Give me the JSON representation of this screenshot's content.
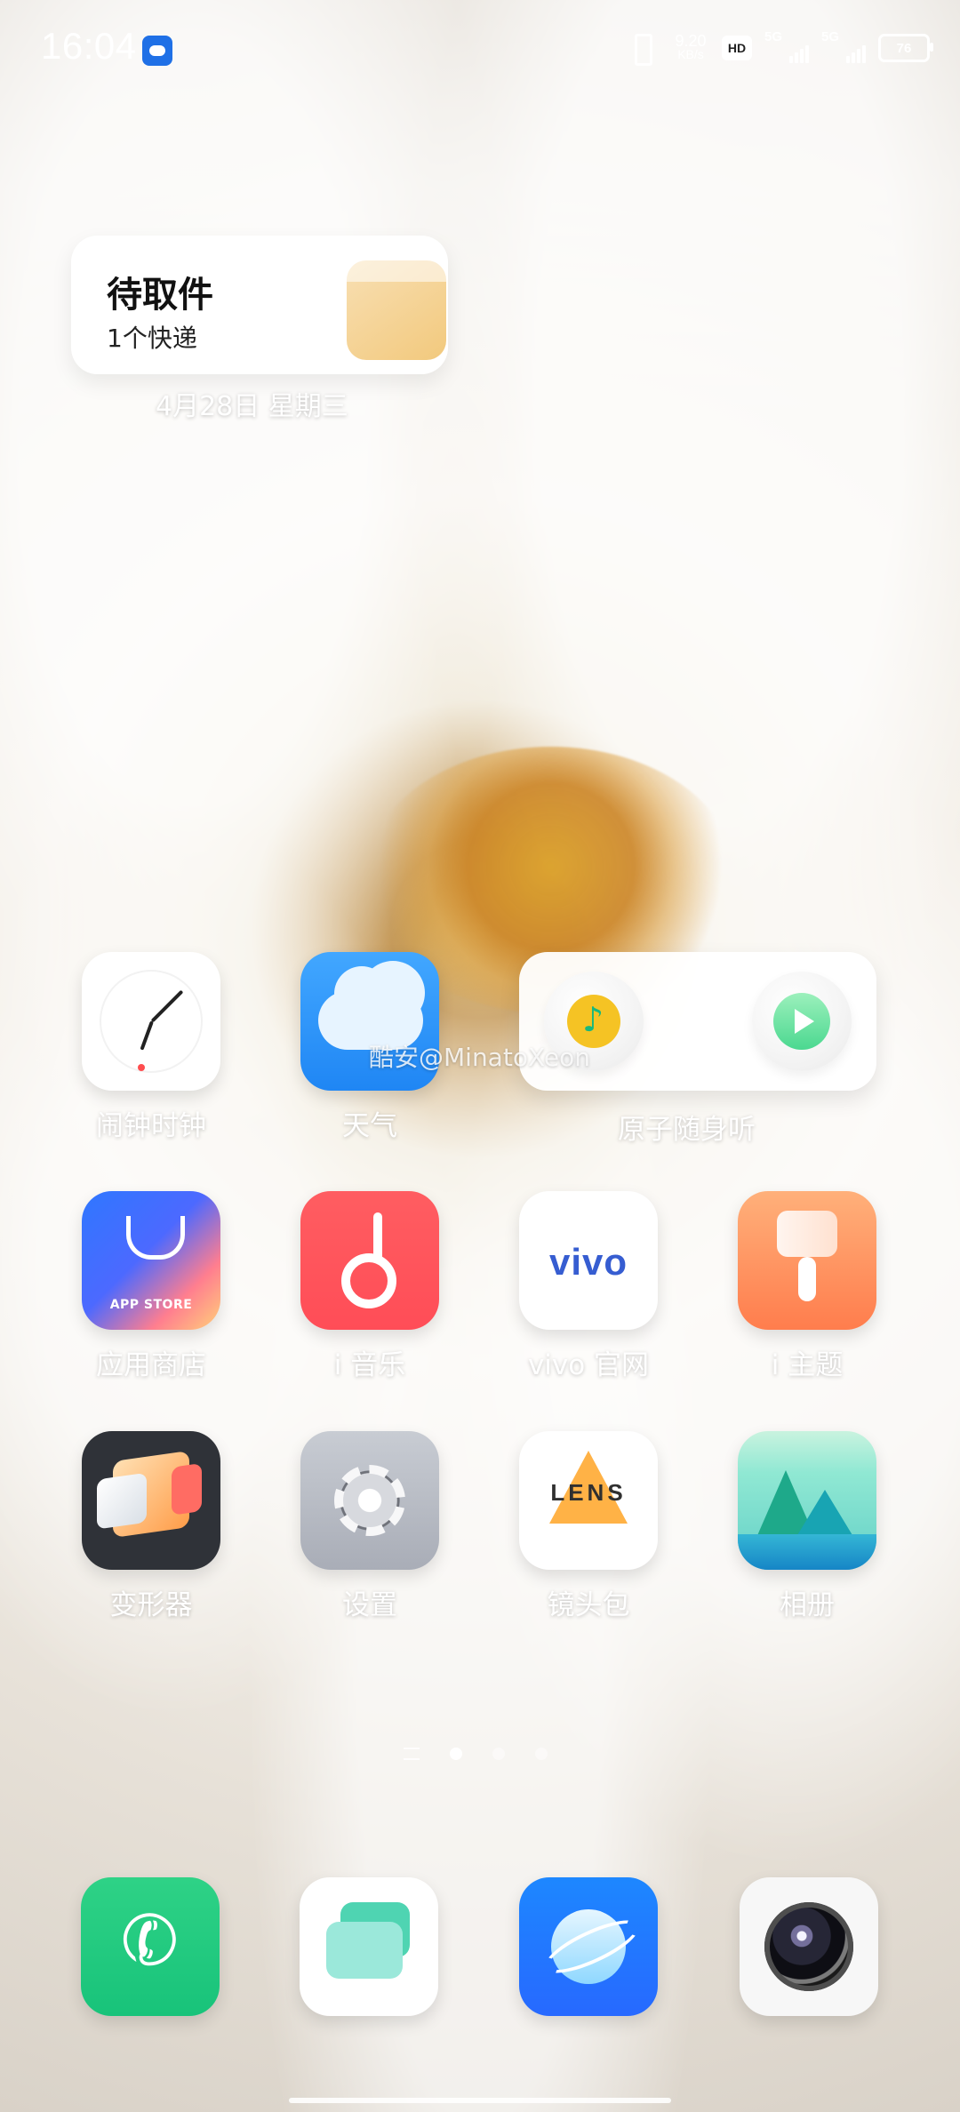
{
  "status_bar": {
    "time": "16:04",
    "speed_value": "9.20",
    "speed_unit": "KB/s",
    "hd": "HD",
    "sim1_network": "5G",
    "sim2_network": "5G",
    "battery": "76"
  },
  "widgets": {
    "package": {
      "title": "待取件",
      "subtitle": "1个快递"
    },
    "date": "4月28日 星期三",
    "music_title": "原子随身听"
  },
  "watermark": "酷安@MinatoXeon",
  "apps": {
    "row1": [
      {
        "label": "闹钟时钟",
        "icon": "clock-icon"
      },
      {
        "label": "天气",
        "icon": "weather-icon"
      }
    ],
    "row2": [
      {
        "label": "应用商店",
        "icon": "app-store-icon",
        "badge_text": "APP STORE"
      },
      {
        "label": "i 音乐",
        "icon": "music-note-icon"
      },
      {
        "label": "vivo 官网",
        "icon": "vivo-logo-icon",
        "brand": "vivo"
      },
      {
        "label": "i 主题",
        "icon": "paintbrush-icon"
      }
    ],
    "row3": [
      {
        "label": "变形器",
        "icon": "cube-icon"
      },
      {
        "label": "设置",
        "icon": "settings-icon"
      },
      {
        "label": "镜头包",
        "icon": "lens-icon",
        "brand": "LENS"
      },
      {
        "label": "相册",
        "icon": "album-icon"
      }
    ]
  },
  "dock": [
    {
      "icon": "phone-icon"
    },
    {
      "icon": "messages-icon"
    },
    {
      "icon": "browser-icon"
    },
    {
      "icon": "camera-icon"
    }
  ],
  "page_indicator": {
    "pages": 3,
    "current_page": 1
  },
  "colors": {
    "accent_blue": "#1f86f4",
    "accent_red": "#ff4d57",
    "accent_green": "#18c37a",
    "accent_orange": "#ff7d4d"
  }
}
